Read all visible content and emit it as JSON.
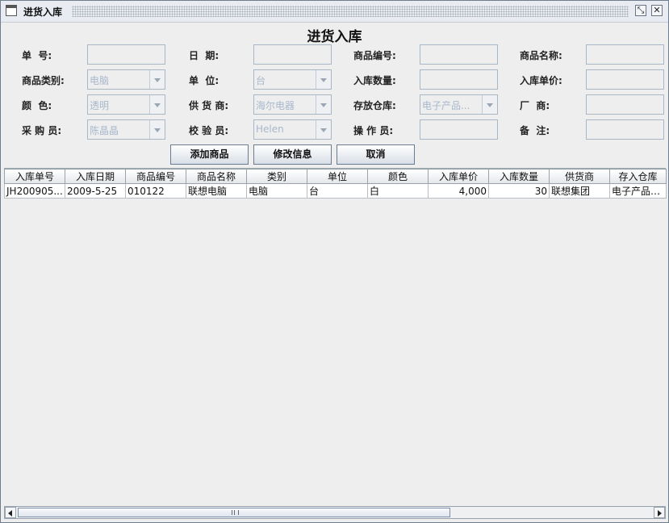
{
  "window": {
    "title": "进货入库",
    "restore_glyph": "⤡",
    "close_glyph": "✕"
  },
  "form": {
    "heading": "进货入库",
    "labels": {
      "order_no": "单  号:",
      "date": "日  期:",
      "product_code": "商品编号:",
      "product_name": "商品名称:",
      "category": "商品类别:",
      "unit": "单  位:",
      "quantity": "入库数量:",
      "unit_price": "入库单价:",
      "color": "颜  色:",
      "supplier": "供 货 商:",
      "warehouse": "存放仓库:",
      "manufacturer": "厂  商:",
      "purchaser": "采 购 员:",
      "inspector": "校 验 员:",
      "operator": "操 作 员:",
      "remarks": "备  注:"
    },
    "combos": {
      "category": "电脑",
      "unit": "台",
      "color": "透明",
      "supplier": "海尔电器",
      "warehouse": "电子产品...",
      "purchaser": "陈晶晶",
      "inspector": "Helen"
    }
  },
  "buttons": {
    "add": "添加商品",
    "modify": "修改信息",
    "cancel": "取消"
  },
  "table": {
    "headers": [
      "入库单号",
      "入库日期",
      "商品编号",
      "商品名称",
      "类别",
      "单位",
      "颜色",
      "入库单价",
      "入库数量",
      "供货商",
      "存入仓库"
    ],
    "rows": [
      [
        "JH200905...",
        "2009-5-25",
        "010122",
        "联想电脑",
        "电脑",
        "台",
        "白",
        "4,000",
        "30",
        "联想集团",
        "电子产品一..."
      ]
    ]
  },
  "icons": {
    "app": "window-icon",
    "restore": "restore-icon",
    "close": "close-icon"
  }
}
